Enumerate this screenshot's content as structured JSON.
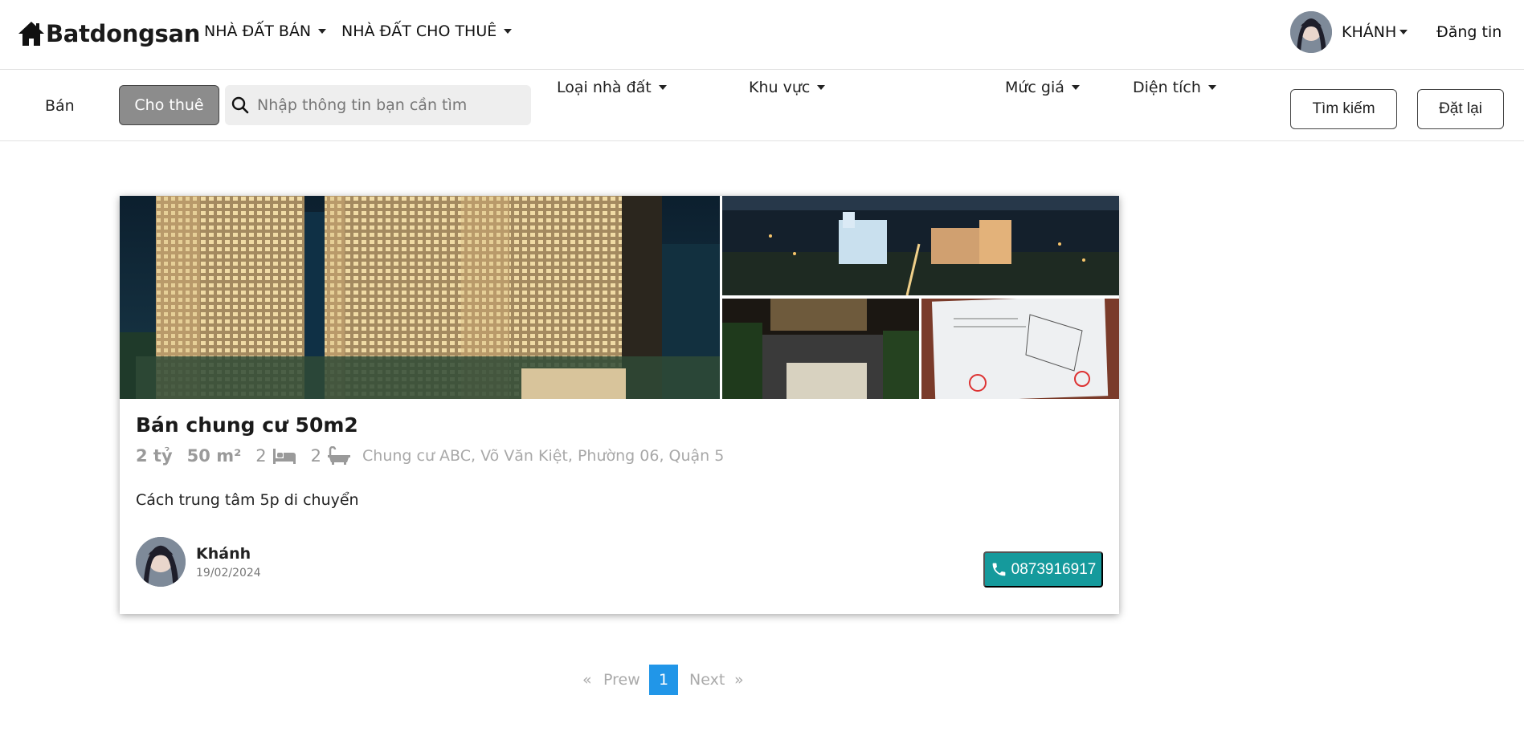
{
  "navbar": {
    "brand": "Batdongsan",
    "menu": [
      {
        "label": "NHÀ ĐẤT BÁN"
      },
      {
        "label": "NHÀ ĐẤT CHO THUÊ"
      }
    ],
    "user_name": "KHÁNH",
    "post_label": "Đăng tin"
  },
  "filters": {
    "tab_sell": "Bán",
    "tab_rent": "Cho thuê",
    "search_placeholder": "Nhập thông tin bạn cần tìm",
    "dropdowns": [
      "Loại nhà đất",
      "Khu vực",
      "Mức giá",
      "Diện tích"
    ],
    "search_button": "Tìm kiếm",
    "reset_button": "Đặt lại"
  },
  "listing": {
    "title": "Bán chung cư 50m2",
    "price": "2 tỷ",
    "area": "50 m²",
    "bedrooms": "2",
    "bathrooms": "2",
    "address": "Chung cư ABC, Võ Văn Kiệt, Phường 06, Quận 5",
    "description": "Cách trung tâm 5p di chuyển",
    "author_name": "Khánh",
    "posted_date": "19/02/2024",
    "phone": "0873916917"
  },
  "pagination": {
    "first": "«",
    "prev": "Prew",
    "current": "1",
    "next": "Next",
    "last": "»"
  },
  "colors": {
    "accent_teal": "#159a9c",
    "active_page": "#2196e8",
    "rent_tab_bg": "#8c8c8c"
  }
}
